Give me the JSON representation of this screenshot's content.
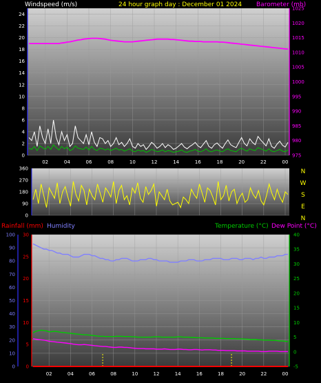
{
  "header": {
    "windspeed_label": "Windspeed (m/s)",
    "title": "24 hour graph day : December 01 2024",
    "barometer_label": "Barometer (mb)"
  },
  "colors": {
    "background": "#000000",
    "plot_top": "#c8c8c8",
    "plot_bottom": "#4a4a4a",
    "grid": "#9a9a9a",
    "wind_speed": "#ffffff",
    "wind_avg": "#00c000",
    "wind_min": "#9cff9c",
    "barometer": "#ff00ff",
    "direction": "#ffff00",
    "rainfall": "#ff0000",
    "humidity": "#8080ff",
    "temperature": "#00cc00",
    "dew_point": "#ff00ff",
    "title": "#ffff00",
    "label": "#ffffff"
  },
  "chart_data": [
    {
      "type": "line",
      "x_ticks": [
        "02",
        "04",
        "06",
        "08",
        "10",
        "12",
        "14",
        "16",
        "18",
        "20",
        "22",
        "00"
      ],
      "y_left_ticks": [
        "0",
        "2",
        "4",
        "6",
        "8",
        "10",
        "12",
        "14",
        "16",
        "18",
        "20",
        "22",
        "24"
      ],
      "y_left_range": [
        0,
        25
      ],
      "y_right_ticks": [
        "975",
        "980",
        "985",
        "990",
        "995",
        "1000",
        "1005",
        "1010",
        "1015",
        "1020",
        "1025"
      ],
      "y_right_range": [
        975,
        1025
      ],
      "grid": true,
      "series": [
        {
          "name": "Windspeed (m/s)",
          "axis": "left",
          "values": [
            3,
            2.5,
            4,
            1.5,
            5,
            3,
            2,
            4.5,
            2,
            6,
            3,
            1.8,
            4,
            2.5,
            3.5,
            1.5,
            2,
            5,
            3,
            2.5,
            2,
            3.5,
            1.8,
            4,
            2.2,
            1.5,
            3,
            2.8,
            2,
            2.5,
            1.5,
            2,
            3,
            1.8,
            2.2,
            1.5,
            2,
            2.8,
            1.5,
            1.2,
            2,
            1.5,
            1.8,
            1,
            1.5,
            2.2,
            1.8,
            1.2,
            1.5,
            2,
            1.3,
            1.8,
            1.5,
            1,
            1.2,
            1.6,
            2,
            1.4,
            1.1,
            1.5,
            1.8,
            2.2,
            1.6,
            1.3,
            1.9,
            2.5,
            1.5,
            1.2,
            1.8,
            2.1,
            1.6,
            1.2,
            2,
            2.6,
            1.8,
            1.5,
            1.3,
            2.2,
            3,
            2,
            1.6,
            2.8,
            2.2,
            1.8,
            3.2,
            2.6,
            2.1,
            1.6,
            2.8,
            1.5,
            1.2,
            1.9,
            2.4,
            1.7,
            1.4,
            2.2
          ]
        },
        {
          "name": "Windspeed average",
          "axis": "left",
          "values": [
            1.2,
            1,
            1.5,
            0.8,
            1.6,
            1.3,
            1,
            1.5,
            1,
            1.8,
            1.3,
            0.9,
            1.5,
            1.1,
            1.4,
            0.8,
            1,
            1.6,
            1.2,
            1.1,
            1,
            1.4,
            0.9,
            1.5,
            1,
            0.8,
            1.2,
            1.1,
            0.9,
            1.1,
            0.8,
            1,
            1.2,
            0.9,
            1,
            0.7,
            0.9,
            1.1,
            0.7,
            0.6,
            0.9,
            0.7,
            0.8,
            0.5,
            0.7,
            1,
            0.8,
            0.6,
            0.7,
            0.9,
            0.6,
            0.8,
            0.7,
            0.5,
            0.6,
            0.7,
            0.9,
            0.6,
            0.5,
            0.7,
            0.8,
            1,
            0.7,
            0.6,
            0.8,
            1.1,
            0.7,
            0.6,
            0.8,
            0.9,
            0.7,
            0.6,
            0.9,
            1.1,
            0.8,
            0.7,
            0.6,
            1,
            1.2,
            0.9,
            0.7,
            1.1,
            0.9,
            0.8,
            1.3,
            1.1,
            0.9,
            0.7,
            1.1,
            0.7,
            0.6,
            0.8,
            1,
            0.7,
            0.6,
            0.9
          ]
        },
        {
          "name": "Barometer (mb)",
          "axis": "right",
          "values": [
            1013,
            1013,
            1013,
            1013,
            1013,
            1013,
            1013,
            1013,
            1013,
            1013,
            1013,
            1013,
            1013.2,
            1013.3,
            1013.5,
            1013.6,
            1013.8,
            1014,
            1014.2,
            1014.3,
            1014.5,
            1014.6,
            1014.7,
            1014.8,
            1014.8,
            1014.8,
            1014.7,
            1014.6,
            1014.5,
            1014.3,
            1014.1,
            1014,
            1013.9,
            1013.8,
            1013.7,
            1013.6,
            1013.6,
            1013.6,
            1013.6,
            1013.7,
            1013.8,
            1013.9,
            1014,
            1014.1,
            1014.2,
            1014.3,
            1014.4,
            1014.5,
            1014.5,
            1014.5,
            1014.5,
            1014.5,
            1014.4,
            1014.4,
            1014.3,
            1014.2,
            1014.1,
            1014,
            1013.9,
            1013.8,
            1013.8,
            1013.7,
            1013.7,
            1013.7,
            1013.6,
            1013.6,
            1013.6,
            1013.6,
            1013.6,
            1013.6,
            1013.5,
            1013.5,
            1013.4,
            1013.3,
            1013.2,
            1013.1,
            1013,
            1012.9,
            1012.8,
            1012.7,
            1012.6,
            1012.5,
            1012.4,
            1012.3,
            1012.2,
            1012.1,
            1012,
            1011.9,
            1011.8,
            1011.7,
            1011.6,
            1011.5,
            1011.4,
            1011.3,
            1011.2,
            1011.1
          ]
        }
      ]
    },
    {
      "type": "scatter",
      "y_ticks": [
        "0",
        "90",
        "180",
        "270",
        "360"
      ],
      "y_range": [
        0,
        360
      ],
      "compass_labels": [
        "N",
        "W",
        "S",
        "E",
        "N"
      ],
      "grid": true,
      "series": [
        {
          "name": "Wind direction",
          "values": [
            120,
            200,
            90,
            240,
            150,
            60,
            210,
            170,
            130,
            250,
            90,
            180,
            220,
            140,
            70,
            260,
            160,
            110,
            230,
            190,
            80,
            200,
            150,
            120,
            240,
            170,
            100,
            210,
            180,
            140,
            260,
            90,
            190,
            230,
            120,
            150,
            80,
            210,
            170,
            250,
            130,
            100,
            220,
            160,
            190,
            240,
            70,
            180,
            150,
            120,
            200,
            110,
            80,
            90,
            100,
            60,
            140,
            120,
            90,
            200,
            160,
            130,
            240,
            170,
            100,
            210,
            190,
            140,
            80,
            260,
            120,
            150,
            230,
            110,
            180,
            200,
            90,
            140,
            170,
            100,
            120,
            210,
            160,
            130,
            190,
            110,
            80,
            150,
            240,
            170,
            120,
            200,
            140,
            100,
            180,
            160
          ]
        }
      ]
    },
    {
      "type": "line",
      "x_ticks": [
        "02",
        "04",
        "06",
        "08",
        "10",
        "12",
        "14",
        "16",
        "18",
        "20",
        "22",
        "00"
      ],
      "y_humidity_ticks": [
        "0",
        "10",
        "20",
        "30",
        "40",
        "50",
        "60",
        "70",
        "80",
        "90",
        "100"
      ],
      "y_humidity_range": [
        0,
        100
      ],
      "y_rain_ticks": [
        "0",
        "5",
        "10",
        "15",
        "20",
        "25",
        "30"
      ],
      "y_rain_range": [
        0,
        30
      ],
      "y_temp_ticks": [
        "-5",
        "0",
        "5",
        "10",
        "15",
        "20",
        "25",
        "30",
        "35",
        "40"
      ],
      "y_temp_range": [
        -5,
        40
      ],
      "grid": true,
      "series": [
        {
          "name": "Rainfall (mm)",
          "axis": "rain",
          "values": [
            0,
            0,
            0,
            0,
            0,
            0,
            0,
            0,
            0,
            0,
            0,
            0,
            0,
            0,
            0,
            0,
            0,
            0,
            0,
            0,
            0,
            0,
            0,
            0,
            0,
            0,
            0,
            0,
            0,
            0,
            0,
            0,
            0,
            0,
            0,
            0,
            0,
            0,
            0,
            0,
            0,
            0,
            0,
            0,
            0,
            0,
            0,
            0,
            0,
            0,
            0,
            0,
            0,
            0,
            0,
            0,
            0,
            0,
            0,
            0,
            0,
            0,
            0,
            0,
            0,
            0,
            0,
            0,
            0,
            0,
            0,
            0,
            0,
            0,
            0,
            0,
            0,
            0,
            0,
            0,
            0,
            0,
            0,
            0,
            0,
            0,
            0,
            0,
            0,
            0,
            0,
            0,
            0,
            0,
            0,
            0
          ]
        },
        {
          "name": "Humidity",
          "axis": "humidity",
          "values": [
            93,
            92,
            91,
            90,
            89,
            89,
            88,
            88,
            87,
            86,
            86,
            85,
            85,
            85,
            84,
            83,
            83,
            83,
            84,
            85,
            85,
            85,
            84,
            84,
            83,
            82,
            82,
            81,
            81,
            80,
            80,
            81,
            81,
            82,
            82,
            82,
            81,
            80,
            80,
            80,
            81,
            81,
            81,
            82,
            82,
            81,
            81,
            80,
            80,
            80,
            80,
            79,
            79,
            79,
            79,
            80,
            80,
            80,
            81,
            81,
            81,
            80,
            80,
            80,
            81,
            81,
            81,
            82,
            82,
            82,
            82,
            81,
            81,
            81,
            82,
            82,
            82,
            81,
            81,
            82,
            82,
            82,
            81,
            82,
            82,
            83,
            82,
            82,
            83,
            83,
            83,
            84,
            84,
            84,
            85,
            85
          ]
        },
        {
          "name": "Temperature (°C)",
          "axis": "temp",
          "values": [
            6.5,
            7,
            7.2,
            7.4,
            7.3,
            7.1,
            6.8,
            6.9,
            7,
            6.9,
            6.7,
            6.6,
            6.5,
            6.4,
            6.3,
            6.2,
            6.1,
            6,
            5.9,
            5.8,
            5.8,
            5.7,
            5.6,
            5.5,
            5.4,
            5.3,
            5.3,
            5.2,
            5.2,
            5.2,
            5.2,
            5.3,
            5.3,
            5.3,
            5.2,
            5.2,
            5.2,
            5.1,
            5.1,
            5,
            5,
            5,
            5,
            5,
            5,
            5.1,
            5.1,
            5.1,
            5,
            5,
            5,
            5,
            5,
            5,
            5.1,
            5.1,
            5,
            5,
            5,
            4.9,
            4.9,
            4.8,
            4.8,
            4.8,
            4.7,
            4.7,
            4.7,
            4.7,
            4.6,
            4.6,
            4.6,
            4.6,
            4.5,
            4.5,
            4.5,
            4.5,
            4.4,
            4.4,
            4.4,
            4.3,
            4.3,
            4.2,
            4.2,
            4.2,
            4.1,
            4.1,
            4,
            4,
            4,
            3.9,
            3.9,
            3.8,
            3.7,
            3.7,
            3.6,
            3.5
          ]
        },
        {
          "name": "Dew Point (°C)",
          "axis": "temp",
          "values": [
            4.5,
            4.3,
            4.2,
            4.1,
            4,
            3.8,
            3.6,
            3.5,
            3.4,
            3.3,
            3.2,
            3.1,
            3,
            2.9,
            2.8,
            2.6,
            2.5,
            2.4,
            2.4,
            2.5,
            2.4,
            2.3,
            2.2,
            2.1,
            2,
            1.9,
            1.8,
            1.8,
            1.7,
            1.6,
            1.5,
            1.5,
            1.6,
            1.6,
            1.5,
            1.5,
            1.4,
            1.3,
            1.2,
            1.1,
            1.1,
            1.1,
            1,
            1,
            1,
            1,
            0.9,
            0.9,
            0.9,
            1,
            0.9,
            0.8,
            0.8,
            0.8,
            0.9,
            0.9,
            0.8,
            0.8,
            0.7,
            0.7,
            0.8,
            0.8,
            0.7,
            0.6,
            0.7,
            0.7,
            0.7,
            0.6,
            0.6,
            0.5,
            0.5,
            0.5,
            0.4,
            0.4,
            0.4,
            0.4,
            0.3,
            0.3,
            0.3,
            0.3,
            0.2,
            0.2,
            0.2,
            0.2,
            0.2,
            0.1,
            0.1,
            0.1,
            0.2,
            0.2,
            0.2,
            0.2,
            0.1,
            0.1,
            0.1,
            0.1
          ]
        }
      ],
      "markers": [
        {
          "x_hour": 7
        },
        {
          "x_hour": 19
        }
      ]
    }
  ],
  "bottom_header": {
    "rainfall_label": "Rainfall (mm)",
    "humidity_label": "Humidity",
    "temperature_label": "Temperature (°C)",
    "dewpoint_label": "Dew Point (°C)"
  }
}
